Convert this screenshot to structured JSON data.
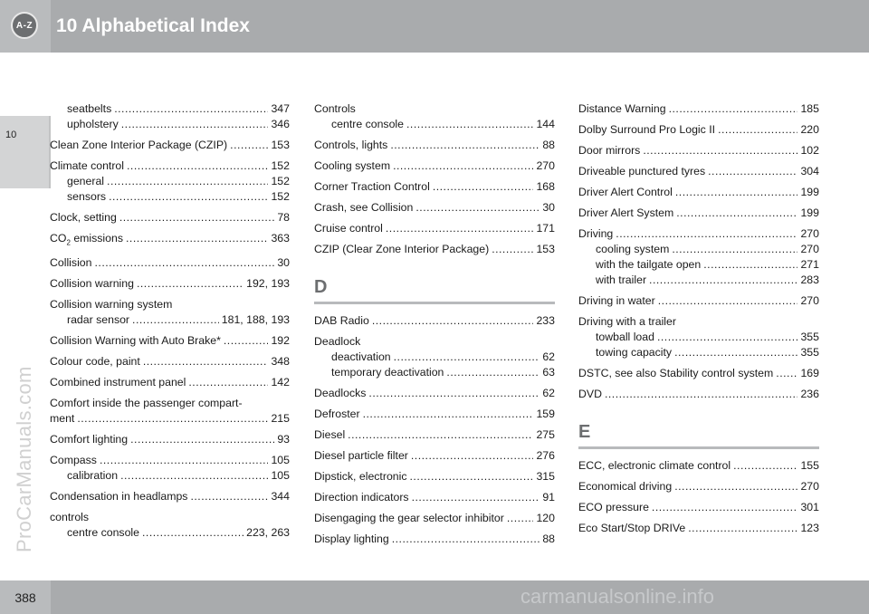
{
  "header": {
    "icon_label": "A-Z",
    "title": "10 Alphabetical Index"
  },
  "chapter_tab": "10",
  "footer": {
    "page_number": "388"
  },
  "watermarks": {
    "side": "ProCarManuals.com",
    "bottom": "carmanualsonline.info"
  },
  "columns": [
    {
      "entries": [
        {
          "lines": [
            {
              "text": "seatbelts",
              "page": "347",
              "indent": true
            },
            {
              "text": "upholstery",
              "page": "346",
              "indent": true
            }
          ]
        },
        {
          "lines": [
            {
              "text": "Clean Zone Interior Package (CZIP)",
              "page": "153"
            }
          ]
        },
        {
          "lines": [
            {
              "text": "Climate control",
              "page": "152"
            },
            {
              "text": "general",
              "page": "152",
              "indent": true
            },
            {
              "text": "sensors",
              "page": "152",
              "indent": true
            }
          ]
        },
        {
          "lines": [
            {
              "text": "Clock, setting",
              "page": "78"
            }
          ]
        },
        {
          "lines": [
            {
              "text": "CO",
              "sub": "2",
              "suffix": " emissions",
              "page": "363"
            }
          ]
        },
        {
          "lines": [
            {
              "text": "Collision",
              "page": "30"
            }
          ]
        },
        {
          "lines": [
            {
              "text": "Collision warning",
              "page": "192, 193"
            }
          ]
        },
        {
          "lines": [
            {
              "text": "Collision warning system"
            },
            {
              "text": "radar sensor",
              "page": "181, 188, 193",
              "indent": true
            }
          ]
        },
        {
          "lines": [
            {
              "text": "Collision Warning with Auto Brake*",
              "page": "192"
            }
          ]
        },
        {
          "lines": [
            {
              "text": "Colour code, paint",
              "page": "348"
            }
          ]
        },
        {
          "lines": [
            {
              "text": "Combined instrument panel",
              "page": "142"
            }
          ]
        },
        {
          "lines": [
            {
              "text": "Comfort inside the passenger compart-"
            },
            {
              "text": "ment",
              "page": "215"
            }
          ]
        },
        {
          "lines": [
            {
              "text": "Comfort lighting",
              "page": "93"
            }
          ]
        },
        {
          "lines": [
            {
              "text": "Compass",
              "page": "105"
            },
            {
              "text": "calibration",
              "page": "105",
              "indent": true
            }
          ]
        },
        {
          "lines": [
            {
              "text": "Condensation in headlamps",
              "page": "344"
            }
          ]
        },
        {
          "lines": [
            {
              "text": "controls"
            },
            {
              "text": "centre console",
              "page": "223, 263",
              "indent": true
            }
          ]
        }
      ]
    },
    {
      "entries": [
        {
          "lines": [
            {
              "text": "Controls"
            },
            {
              "text": "centre console",
              "page": "144",
              "indent": true
            }
          ]
        },
        {
          "lines": [
            {
              "text": "Controls, lights",
              "page": "88"
            }
          ]
        },
        {
          "lines": [
            {
              "text": "Cooling system",
              "page": "270"
            }
          ]
        },
        {
          "lines": [
            {
              "text": "Corner Traction Control",
              "page": "168"
            }
          ]
        },
        {
          "lines": [
            {
              "text": "Crash, see Collision",
              "page": "30"
            }
          ]
        },
        {
          "lines": [
            {
              "text": "Cruise control",
              "page": "171"
            }
          ]
        },
        {
          "lines": [
            {
              "text": "CZIP (Clear Zone Interior Package)",
              "page": "153"
            }
          ]
        },
        {
          "letter": "D"
        },
        {
          "lines": [
            {
              "text": "DAB Radio",
              "page": "233"
            }
          ]
        },
        {
          "lines": [
            {
              "text": "Deadlock"
            },
            {
              "text": "deactivation",
              "page": "62",
              "indent": true
            },
            {
              "text": "temporary deactivation",
              "page": "63",
              "indent": true
            }
          ]
        },
        {
          "lines": [
            {
              "text": "Deadlocks",
              "page": "62"
            }
          ]
        },
        {
          "lines": [
            {
              "text": "Defroster",
              "page": "159"
            }
          ]
        },
        {
          "lines": [
            {
              "text": "Diesel",
              "page": "275"
            }
          ]
        },
        {
          "lines": [
            {
              "text": "Diesel particle filter",
              "page": "276"
            }
          ]
        },
        {
          "lines": [
            {
              "text": "Dipstick, electronic",
              "page": "315"
            }
          ]
        },
        {
          "lines": [
            {
              "text": "Direction indicators",
              "page": "91"
            }
          ]
        },
        {
          "lines": [
            {
              "text": "Disengaging the gear selector inhibitor",
              "page": "120"
            }
          ]
        },
        {
          "lines": [
            {
              "text": "Display lighting",
              "page": "88"
            }
          ]
        }
      ]
    },
    {
      "entries": [
        {
          "lines": [
            {
              "text": "Distance Warning",
              "page": "185"
            }
          ]
        },
        {
          "lines": [
            {
              "text": "Dolby Surround Pro Logic II",
              "page": "220"
            }
          ]
        },
        {
          "lines": [
            {
              "text": "Door mirrors",
              "page": "102"
            }
          ]
        },
        {
          "lines": [
            {
              "text": "Driveable punctured tyres",
              "page": "304"
            }
          ]
        },
        {
          "lines": [
            {
              "text": "Driver Alert Control",
              "page": "199"
            }
          ]
        },
        {
          "lines": [
            {
              "text": "Driver Alert System",
              "page": "199"
            }
          ]
        },
        {
          "lines": [
            {
              "text": "Driving",
              "page": "270"
            },
            {
              "text": "cooling system",
              "page": "270",
              "indent": true
            },
            {
              "text": "with the tailgate open",
              "page": "271",
              "indent": true
            },
            {
              "text": "with trailer",
              "page": "283",
              "indent": true
            }
          ]
        },
        {
          "lines": [
            {
              "text": "Driving in water",
              "page": "270"
            }
          ]
        },
        {
          "lines": [
            {
              "text": "Driving with a trailer"
            },
            {
              "text": "towball load",
              "page": "355",
              "indent": true
            },
            {
              "text": "towing capacity",
              "page": "355",
              "indent": true
            }
          ]
        },
        {
          "lines": [
            {
              "text": "DSTC, see also Stability control system",
              "page": "169"
            }
          ]
        },
        {
          "lines": [
            {
              "text": "DVD",
              "page": "236"
            }
          ]
        },
        {
          "letter": "E"
        },
        {
          "lines": [
            {
              "text": "ECC, electronic climate control",
              "page": "155"
            }
          ]
        },
        {
          "lines": [
            {
              "text": "Economical driving",
              "page": "270"
            }
          ]
        },
        {
          "lines": [
            {
              "text": "ECO pressure",
              "page": "301"
            }
          ]
        },
        {
          "lines": [
            {
              "text": "Eco Start/Stop DRIVe",
              "page": "123"
            }
          ]
        }
      ]
    }
  ]
}
